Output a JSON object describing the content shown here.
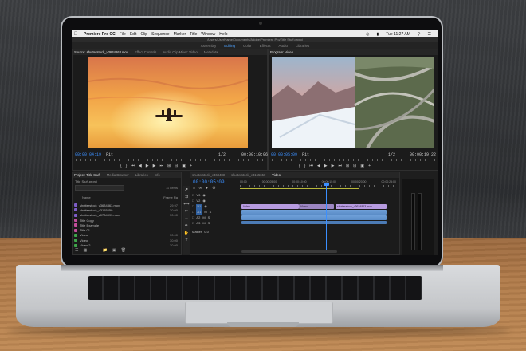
{
  "app": {
    "name": "Premiere Pro CC",
    "menu": [
      "File",
      "Edit",
      "Clip",
      "Sequence",
      "Marker",
      "Title",
      "Window",
      "Help"
    ],
    "clock": "Tue 11:27 AM",
    "path": "/Users/UserName/Documents/Adobe/Premiere Pro/Title Stuff.prproj",
    "workspaces": [
      "Assembly",
      "Editing",
      "Color",
      "Effects",
      "Audio",
      "Libraries"
    ],
    "active_workspace": "Editing"
  },
  "source_monitor": {
    "tabs": [
      "Source: shutterstock_v3634863.mov",
      "Effect Controls",
      "Audio Clip Mixer: Video",
      "Metadata"
    ],
    "timecode_in": "00:00:04:19",
    "fit": "Fit",
    "resolution": "1/2",
    "timecode_out": "00:00:10:06"
  },
  "program_monitor": {
    "tabs": [
      "Program: Video"
    ],
    "timecode_in": "00:00:05:09",
    "fit": "Fit",
    "resolution": "1/2",
    "timecode_out": "00:00:19:22"
  },
  "project_panel": {
    "tabs": [
      "Project: Title Stuff",
      "Media Browser",
      "Libraries",
      "Info"
    ],
    "file": "Title Stuff.prproj",
    "count": "11 Items",
    "col_name": "Name",
    "col_rate": "Frame Ra",
    "items": [
      {
        "name": "shutterstock_v3634863.mov",
        "rate": "29.97",
        "color": "#7d5cc6"
      },
      {
        "name": "shutterstock_v3155650",
        "rate": "30.00",
        "color": "#7d5cc6"
      },
      {
        "name": "shutterstock_v0734993.mov",
        "rate": "30.00",
        "color": "#7d5cc6"
      },
      {
        "name": "Title Copy",
        "rate": "",
        "color": "#c24d9a"
      },
      {
        "name": "Title Example",
        "rate": "",
        "color": "#c24d9a"
      },
      {
        "name": "Title 01",
        "rate": "",
        "color": "#c24d9a"
      },
      {
        "name": "Video",
        "rate": "30.00",
        "color": "#3ea54a"
      },
      {
        "name": "Video",
        "rate": "30.00",
        "color": "#3ea54a"
      },
      {
        "name": "Video 2",
        "rate": "30.00",
        "color": "#3ea54a"
      }
    ]
  },
  "timeline": {
    "tabs": [
      "shutterstock_v363483",
      "shutterstock_v3155650",
      "Video"
    ],
    "timecode": "00:00:05:09",
    "ruler": [
      "00:00",
      "00:00:05:00",
      "00:00:10:00",
      "00:00:15:00",
      "00:00:20:00",
      "00:00:25:00"
    ],
    "track_labels": [
      "V3",
      "V2",
      "V1",
      "A1",
      "A2",
      "A3",
      "Master"
    ],
    "clip_labels": [
      "Video",
      "Video",
      "Video",
      "shutterstock_v3634863.mov"
    ],
    "master_value": "0.0"
  }
}
